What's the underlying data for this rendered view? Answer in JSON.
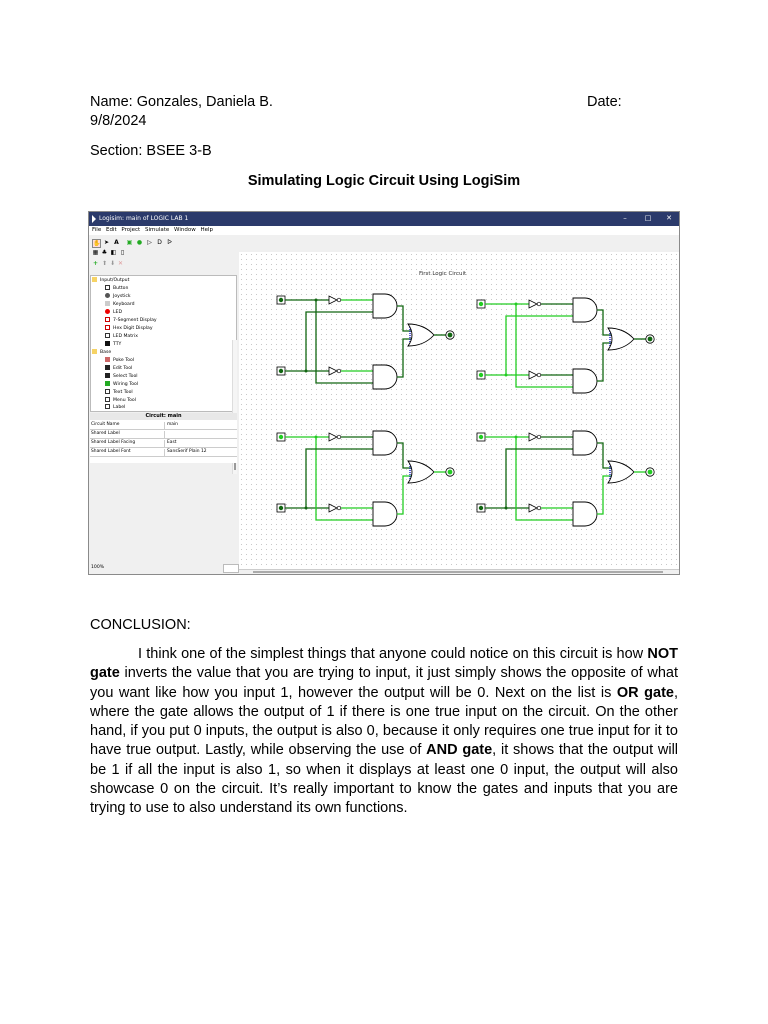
{
  "header": {
    "name_line": "Name: Gonzales, Daniela B.",
    "date_label": "Date:",
    "date_value": "9/8/2024",
    "section_line": "Section: BSEE 3-B",
    "title": "Simulating Logic Circuit Using LogiSim"
  },
  "screenshot": {
    "window_title": "Logisim: main of LOGIC LAB 1",
    "window_controls": [
      "–",
      "□",
      "✕"
    ],
    "menu": [
      "File",
      "Edit",
      "Project",
      "Simulate",
      "Window",
      "Help"
    ],
    "explorer": {
      "folders": [
        "Input/Output",
        "Base"
      ],
      "io_items": [
        "Button",
        "Joystick",
        "Keyboard",
        "LED",
        "7-Segment Display",
        "Hex Digit Display",
        "LED Matrix",
        "TTY"
      ],
      "base_items": [
        "Poke Tool",
        "Edit Tool",
        "Select Tool",
        "Wiring Tool",
        "Text Tool",
        "Menu Tool",
        "Label"
      ]
    },
    "properties": {
      "title": "Circuit: main",
      "rows": [
        {
          "key": "Circuit Name",
          "value": "main"
        },
        {
          "key": "Shared Label",
          "value": ""
        },
        {
          "key": "Shared Label Facing",
          "value": "East"
        },
        {
          "key": "Shared Label Font",
          "value": "SansSerif Plain 12"
        }
      ]
    },
    "zoom": "100%",
    "canvas_label": "First Logic Circuit",
    "circuits": [
      {
        "input_a": 0,
        "input_b": 0,
        "output": 0
      },
      {
        "input_a": 1,
        "input_b": 1,
        "output": 0
      },
      {
        "input_a": 1,
        "input_b": 0,
        "output": 1
      },
      {
        "input_a": 1,
        "input_b": 0,
        "output": 1
      }
    ],
    "colors": {
      "wire_on": "#22cc22",
      "wire_off": "#116611",
      "titlebar": "#2b3a6b",
      "bus": "#2222cc"
    }
  },
  "conclusion": {
    "heading": "CONCLUSION:",
    "p1": "I think one of the simplest things that anyone could notice on this circuit is how ",
    "b1": "NOT gate",
    "p2": " inverts the value that you are trying to input, it just simply shows the opposite of what you want like how you input 1, however the output will be 0. Next on the list is ",
    "b2": "OR gate",
    "p3": ", where the gate allows the output of 1 if there is one true input on the circuit. On the other hand, if you put 0 inputs, the output is also 0, because it only requires one true input for it to have true output. Lastly, while observing the use of ",
    "b3": "AND gate",
    "p4": ", it shows that the output will be 1 if all the input is also 1, so when it displays at least one 0 input, the output will also showcase 0 on the circuit. It’s really important to know the gates and inputs that you are trying to use to also understand its own functions."
  }
}
